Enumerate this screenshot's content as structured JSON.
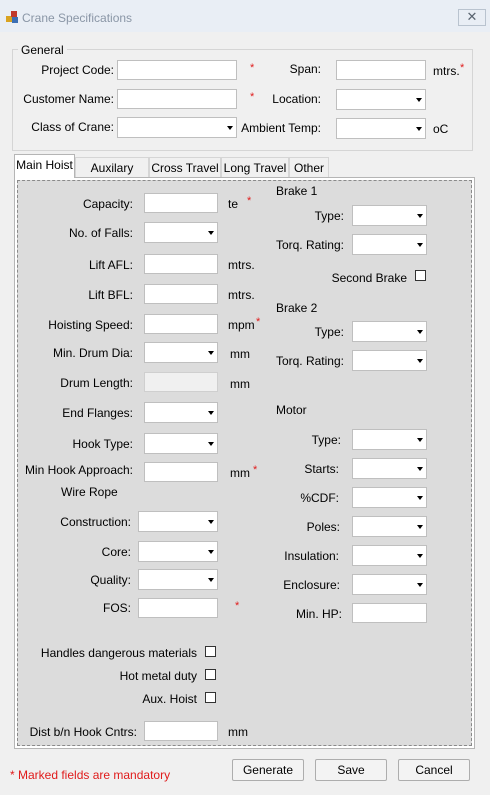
{
  "window": {
    "title": "Crane Specifications",
    "close_glyph": "✕"
  },
  "general": {
    "group_label": "General",
    "project_code_label": "Project Code:",
    "customer_name_label": "Customer Name:",
    "class_of_crane_label": "Class of Crane:",
    "span_label": "Span:",
    "span_unit": "mtrs.",
    "location_label": "Location:",
    "ambient_temp_label": "Ambient Temp:",
    "ambient_temp_unit": "oC",
    "required_mark": "*"
  },
  "tabs": [
    {
      "label": "Main Hoist",
      "active": true
    },
    {
      "label": "Auxilary Hoist",
      "active": false
    },
    {
      "label": "Cross Travel",
      "active": false
    },
    {
      "label": "Long Travel",
      "active": false
    },
    {
      "label": "Other",
      "active": false
    }
  ],
  "main_hoist": {
    "capacity_label": "Capacity:",
    "capacity_unit": "te",
    "no_of_falls_label": "No. of Falls:",
    "lift_afl_label": "Lift AFL:",
    "lift_afl_unit": "mtrs.",
    "lift_bfl_label": "Lift BFL:",
    "lift_bfl_unit": "mtrs.",
    "hoisting_speed_label": "Hoisting Speed:",
    "hoisting_speed_unit": "mpm",
    "min_drum_dia_label": "Min. Drum Dia:",
    "min_drum_dia_unit": "mm",
    "drum_length_label": "Drum Length:",
    "drum_length_unit": "mm",
    "end_flanges_label": "End Flanges:",
    "hook_type_label": "Hook Type:",
    "min_hook_approach_label": "Min Hook Approach:",
    "min_hook_approach_unit": "mm",
    "wire_rope_label": "Wire Rope",
    "construction_label": "Construction:",
    "core_label": "Core:",
    "quality_label": "Quality:",
    "fos_label": "FOS:",
    "handles_dangerous_label": "Handles dangerous materials",
    "hot_metal_label": "Hot metal duty",
    "aux_hoist_label": "Aux. Hoist",
    "dist_hook_label": "Dist b/n Hook Cntrs:",
    "dist_hook_unit": "mm",
    "brake1_label": "Brake 1",
    "brake1_type_label": "Type:",
    "brake1_torq_label": "Torq. Rating:",
    "second_brake_label": "Second Brake",
    "brake2_label": "Brake 2",
    "brake2_type_label": "Type:",
    "brake2_torq_label": "Torq. Rating:",
    "motor_label": "Motor",
    "motor_type_label": "Type:",
    "starts_label": "Starts:",
    "cdf_label": "%CDF:",
    "poles_label": "Poles:",
    "insulation_label": "Insulation:",
    "enclosure_label": "Enclosure:",
    "min_hp_label": "Min. HP:"
  },
  "footer": {
    "mandatory_note": "* Marked fields are mandatory",
    "generate_label": "Generate",
    "save_label": "Save",
    "cancel_label": "Cancel"
  }
}
